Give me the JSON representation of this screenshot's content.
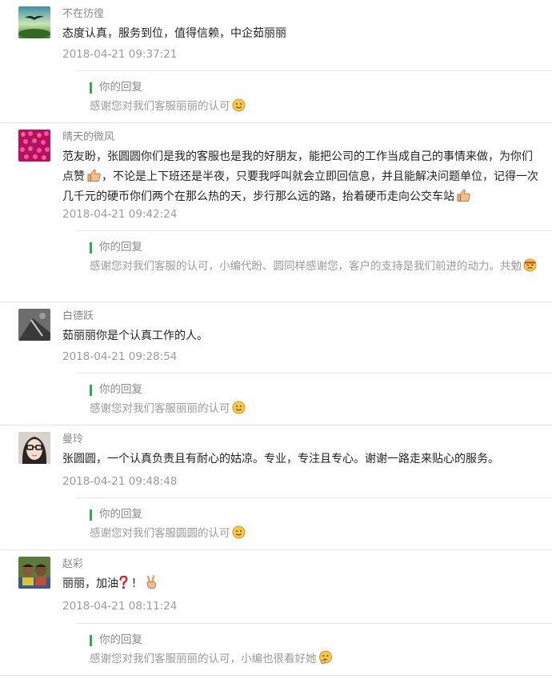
{
  "reply_label": "你的回复",
  "comments": [
    {
      "name": "不在彷徨",
      "content": "态度认真，服务到位，值得信赖，中企茹丽丽",
      "content_emoji": "",
      "time": "2018-04-21 09:37:21",
      "reply": "感谢您对我们客服丽丽的认可",
      "reply_emoji": "smile-emoji-icon"
    },
    {
      "name": "晴天的微风",
      "content_part1": "范友盼，张圆圆你们是我的客服也是我的好朋友，能把公司的工作当成自己的事情来做，为你们点赞",
      "content_part2": "，不论是上下班还是半夜，只要我呼叫就会立即回信息，并且能解决问题单位，记得一次几千元的硬币你们两个在那么热的天，步行那么远的路，抬着硬币走向公交车站",
      "content_emoji": "thumbs-up-emoji-icon",
      "time": "2018-04-21 09:42:24",
      "reply": "感谢您对我们客服的认可，小编代盼、圆同样感谢您，客户的支持是我们前进的动力。共勉",
      "reply_emoji": "determined-emoji-icon"
    },
    {
      "name": "白德跃",
      "content": "茹丽丽你是个认真工作的人。",
      "content_emoji": "",
      "time": "2018-04-21 09:28:54",
      "reply": "感谢您对我们客服丽丽的认可",
      "reply_emoji": "smile-emoji-icon"
    },
    {
      "name": "曼玲",
      "content": "张圆圆，一个认真负责且有耐心的姑凉。专业，专注且专心。谢谢一路走来贴心的服务。",
      "content_emoji": "",
      "time": "2018-04-21 09:48:48",
      "reply": "感谢您对我们客服圆圆的认可",
      "reply_emoji": "smile-emoji-icon"
    },
    {
      "name": "赵彩",
      "content": "丽丽，加油",
      "content_tail": "！",
      "content_emoji": "question-mark-emoji-icon",
      "time": "2018-04-21 08:11:24",
      "reply": "感谢您对我们客服丽丽的认可，小编也很看好她",
      "reply_emoji": "thinking-emoji-icon"
    }
  ]
}
